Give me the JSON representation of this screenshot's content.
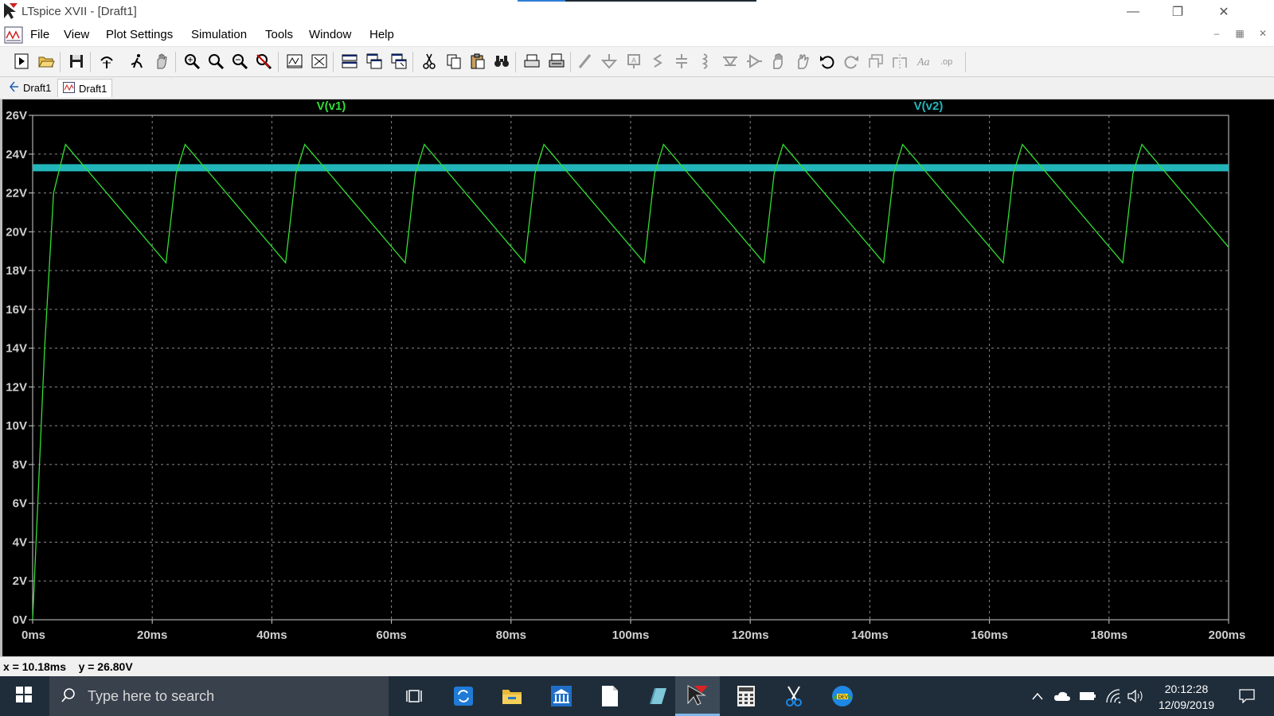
{
  "window": {
    "title": "LTspice XVII - [Draft1]"
  },
  "menu": {
    "items": [
      "File",
      "View",
      "Plot Settings",
      "Simulation",
      "Tools",
      "Window",
      "Help"
    ]
  },
  "toolbar": {
    "icons": [
      "new-schematic-icon",
      "open-icon",
      "save-icon",
      "control-panel-icon",
      "run-icon",
      "halt-icon",
      "zoom-in-icon",
      "zoom-full-icon",
      "zoom-out-icon",
      "autorange-icon",
      "add-plot-pane-icon",
      "delete-plot-pane-icon",
      "tile-horizontal-icon",
      "cascade-icon",
      "tile-vertical-icon",
      "cut-icon",
      "copy-icon",
      "paste-icon",
      "find-icon",
      "print-icon",
      "print-setup-icon",
      "wire-icon",
      "ground-icon",
      "label-icon",
      "resistor-icon",
      "capacitor-icon",
      "inductor-icon",
      "diode-icon",
      "component-icon",
      "move-icon",
      "drag-icon",
      "undo-icon",
      "redo-icon",
      "rotate-icon",
      "mirror-icon",
      "text-icon",
      "spice-directive-icon"
    ]
  },
  "tabs": [
    {
      "label": "Draft1",
      "icon": "schematic-icon"
    },
    {
      "label": "Draft1",
      "icon": "waveform-icon"
    }
  ],
  "plot": {
    "trace_labels": [
      "V(v1)",
      "V(v2)"
    ]
  },
  "colors": {
    "v1": "#33dd33",
    "v2": "#22b6bb",
    "grid": "#8a8a8a",
    "plot_bg": "#000000"
  },
  "chart_data": {
    "type": "line",
    "title": "",
    "xlabel": "",
    "ylabel": "",
    "xlim": [
      0,
      200
    ],
    "ylim": [
      0,
      26
    ],
    "x_unit": "ms",
    "y_unit": "V",
    "x_ticks": [
      "0ms",
      "20ms",
      "40ms",
      "60ms",
      "80ms",
      "100ms",
      "120ms",
      "140ms",
      "160ms",
      "180ms",
      "200ms"
    ],
    "y_ticks": [
      "0V",
      "2V",
      "4V",
      "6V",
      "8V",
      "10V",
      "12V",
      "14V",
      "16V",
      "18V",
      "20V",
      "22V",
      "24V",
      "26V"
    ],
    "grid": true,
    "series": [
      {
        "name": "V(v1)",
        "x": [
          0,
          2,
          3.5,
          5.5,
          22.3,
          24,
          25.5,
          42.3,
          44,
          45.5,
          62.3,
          64,
          65.5,
          82.3,
          84,
          85.5,
          102.3,
          104,
          105.5,
          122.3,
          124,
          125.5,
          142.3,
          144,
          145.5,
          162.3,
          164,
          165.5,
          182.3,
          184,
          185.5,
          200
        ],
        "y": [
          0,
          14,
          22,
          24.5,
          18.4,
          23,
          24.5,
          18.4,
          23,
          24.5,
          18.4,
          23,
          24.5,
          18.4,
          23,
          24.5,
          18.4,
          23,
          24.5,
          18.4,
          23,
          24.5,
          18.4,
          23,
          24.5,
          18.4,
          23,
          24.5,
          18.4,
          23,
          24.5,
          19.2
        ]
      },
      {
        "name": "V(v2)",
        "x": [
          0,
          200
        ],
        "y": [
          23.3,
          23.3
        ]
      }
    ]
  },
  "status": {
    "cursor_readout": "x = 10.18ms    y = 26.80V"
  },
  "taskbar": {
    "search_placeholder": "Type here to search",
    "time": "20:12:28",
    "date": "12/09/2019",
    "apps": [
      "task-view-icon",
      "sync-app-icon",
      "file-explorer-icon",
      "bank-app-icon",
      "document-app-icon",
      "notebook-app-icon",
      "ltspice-app-icon",
      "calculator-app-icon",
      "snipping-tool-icon",
      "dev-app-icon"
    ]
  }
}
